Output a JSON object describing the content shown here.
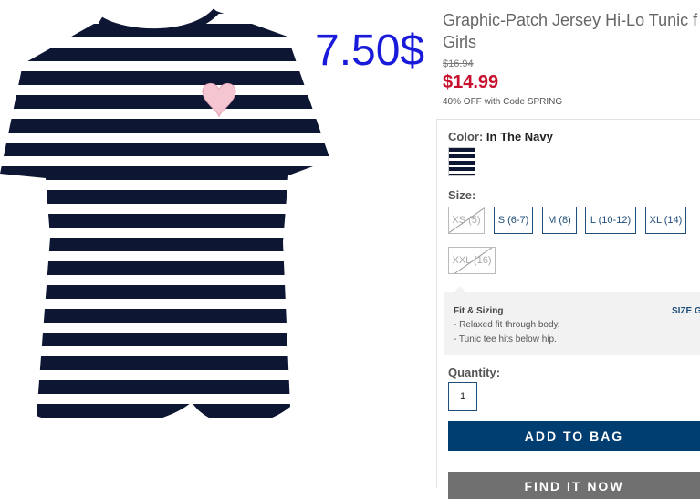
{
  "overlay_price": "7.50$",
  "product": {
    "title_line1": "Graphic-Patch Jersey Hi-Lo Tunic f",
    "title_line2": "Girls",
    "old_price": "$16.94",
    "sale_price": "$14.99",
    "promo": "40% OFF with Code SPRING"
  },
  "color": {
    "label": "Color:",
    "value": "In The Navy",
    "swatch_colors": [
      "#0d1633",
      "#ffffff"
    ]
  },
  "size": {
    "label": "Size:",
    "options": [
      {
        "label": "XS (5)",
        "available": false
      },
      {
        "label": "S (6-7)",
        "available": true
      },
      {
        "label": "M (8)",
        "available": true
      },
      {
        "label": "L (10-12)",
        "available": true
      },
      {
        "label": "XL (14)",
        "available": true
      },
      {
        "label": "XXL (16)",
        "available": false
      }
    ]
  },
  "fit": {
    "title": "Fit & Sizing",
    "size_guide": "SIZE G",
    "items": [
      "- Relaxed fit through body.",
      "- Tunic tee hits below hip."
    ]
  },
  "quantity": {
    "label": "Quantity:",
    "value": "1"
  },
  "buttons": {
    "add_to_bag": "ADD TO BAG",
    "find_it_now": "FIND IT NOW"
  },
  "colors": {
    "navy": "#0d1633",
    "sale_red": "#c8102e",
    "button_blue": "#003e72",
    "link_blue": "#1f4e79",
    "overlay_blue": "#1a1adb"
  }
}
